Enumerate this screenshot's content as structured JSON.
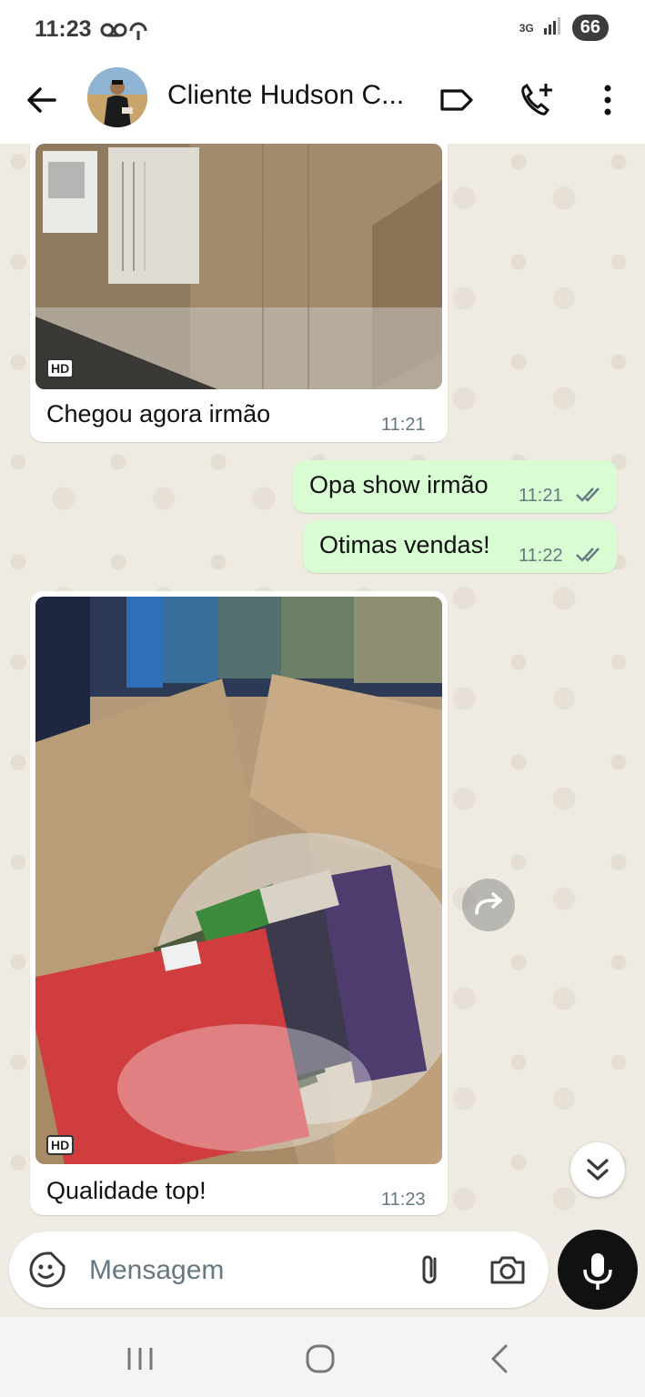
{
  "status_bar": {
    "time": "11:23",
    "network": "3G",
    "battery": "66"
  },
  "header": {
    "contact_name": "Cliente Hudson C..."
  },
  "messages": [
    {
      "direction": "in",
      "type": "image",
      "hd": "HD",
      "caption": "Chegou agora irmão",
      "time": "11:21"
    },
    {
      "direction": "out",
      "type": "text",
      "text": "Opa show irmão",
      "time": "11:21",
      "status": "read"
    },
    {
      "direction": "out",
      "type": "text",
      "text": "Otimas vendas!",
      "time": "11:22",
      "status": "read"
    },
    {
      "direction": "in",
      "type": "image",
      "hd": "HD",
      "caption": "Qualidade top!",
      "time": "11:23"
    }
  ],
  "composer": {
    "placeholder": "Mensagem"
  },
  "colors": {
    "chat_background": "#efeae2",
    "outgoing_bubble": "#d9fdd3",
    "incoming_bubble": "#ffffff",
    "read_ticks": "#667781"
  }
}
